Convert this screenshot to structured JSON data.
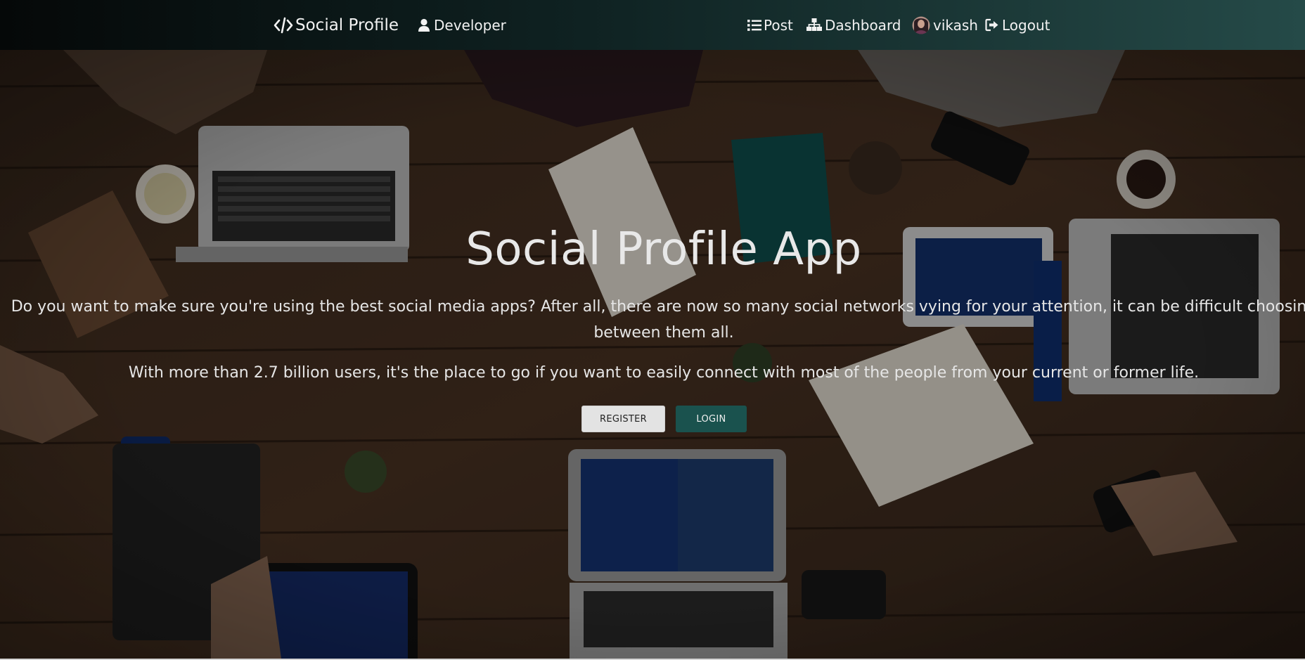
{
  "navbar": {
    "brand_icon": "code-icon",
    "brand_label": "Social Profile",
    "developer_icon": "user-icon",
    "developer_label": "Developer",
    "post_icon": "list-icon",
    "post_label": "Post",
    "dashboard_icon": "sitemap-icon",
    "dashboard_label": "Dashboard",
    "user_avatar": "avatar",
    "user_label": "vikash",
    "logout_icon": "sign-out-icon",
    "logout_label": "Logout"
  },
  "hero": {
    "title": "Social Profile App",
    "paragraph1": "Do you want to make sure you're using the best social media apps? After all, there are now so many social networks vying for your attention, it can be difficult choosing between them all.",
    "paragraph2": "With more than 2.7 billion users, it's the place to go if you want to easily connect with most of the people from your current or former life.",
    "register_label": "REGISTER",
    "login_label": "LOGIN",
    "background_image": "people-working-with-laptops-on-wooden-table"
  },
  "colors": {
    "navbar_start": "#050808",
    "navbar_end": "#254a48",
    "login_button": "#1a524e",
    "register_button": "#e3e3e3"
  }
}
